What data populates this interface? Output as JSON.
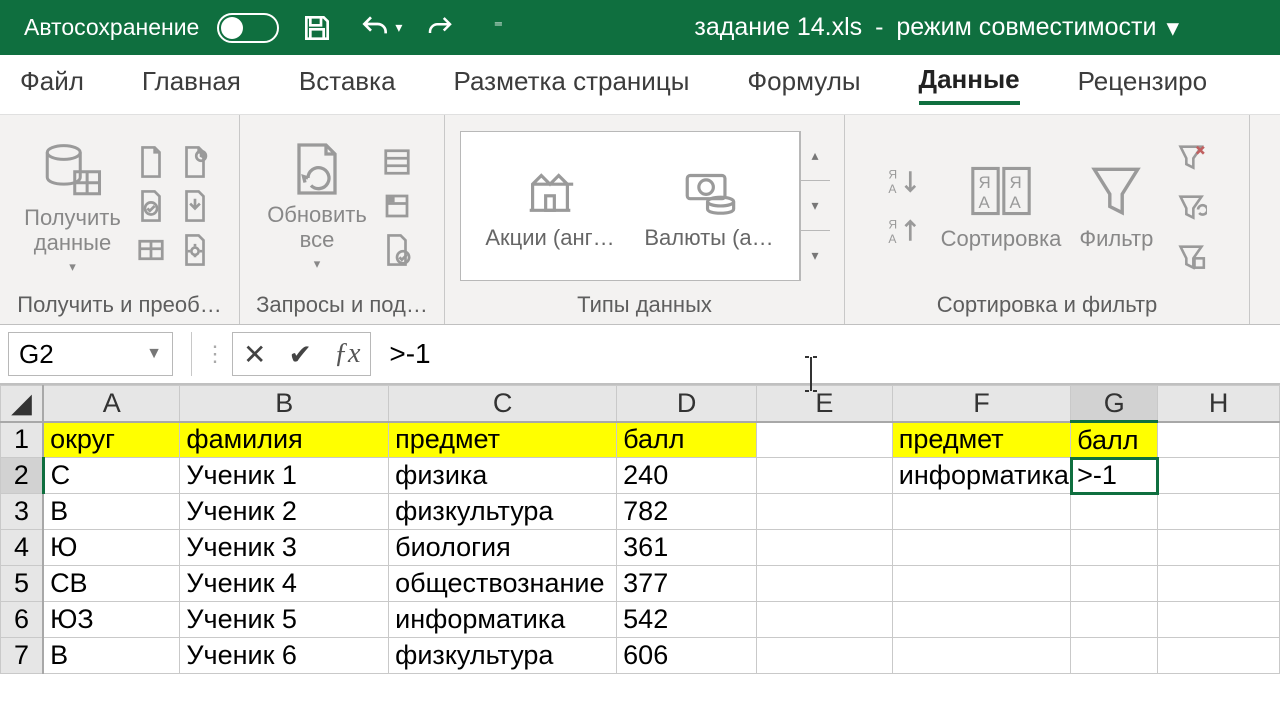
{
  "titlebar": {
    "autosave_label": "Автосохранение",
    "doc_name": "задание 14.xls",
    "mode": "режим совместимости"
  },
  "tabs": {
    "file": "Файл",
    "home": "Главная",
    "insert": "Вставка",
    "layout": "Разметка страницы",
    "formulas": "Формулы",
    "data": "Данные",
    "review": "Рецензиро"
  },
  "ribbon": {
    "get_data": "Получить\nданные",
    "get_group": "Получить и преоб…",
    "refresh": "Обновить\nвсе",
    "queries_group": "Запросы и под…",
    "stocks": "Акции (анг…",
    "currencies": "Валюты (а…",
    "types_group": "Типы данных",
    "sort": "Сортировка",
    "filter": "Фильтр",
    "sortfilter_group": "Сортировка и фильтр"
  },
  "formula": {
    "namebox": "G2",
    "value": ">-1"
  },
  "columns": [
    "A",
    "B",
    "C",
    "D",
    "E",
    "F",
    "G",
    "H"
  ],
  "headerRow": {
    "A": "округ",
    "B": "фамилия",
    "C": "предмет",
    "D": "балл",
    "F": "предмет",
    "G": "балл"
  },
  "criteriaRow": {
    "F": "информатика",
    "G": ">-1"
  },
  "rows": [
    {
      "n": 2,
      "A": "С",
      "B": "Ученик 1",
      "C": "физика",
      "D": "240"
    },
    {
      "n": 3,
      "A": "В",
      "B": "Ученик 2",
      "C": "физкультура",
      "D": "782"
    },
    {
      "n": 4,
      "A": "Ю",
      "B": "Ученик 3",
      "C": "биология",
      "D": "361"
    },
    {
      "n": 5,
      "A": "СВ",
      "B": "Ученик 4",
      "C": "обществознание",
      "D": "377"
    },
    {
      "n": 6,
      "A": "ЮЗ",
      "B": "Ученик 5",
      "C": "информатика",
      "D": "542"
    },
    {
      "n": 7,
      "A": "В",
      "B": "Ученик 6",
      "C": "физкультура",
      "D": "606"
    }
  ],
  "active_cell": "G2"
}
